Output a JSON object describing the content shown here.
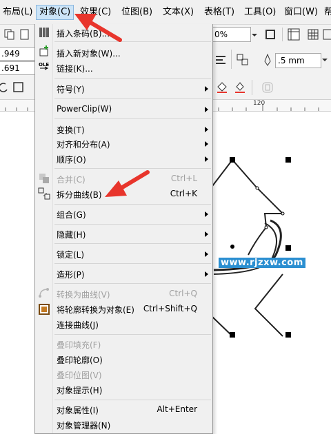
{
  "menubar": {
    "items": [
      {
        "label": "布局(L)"
      },
      {
        "label": "对象(C)"
      },
      {
        "label": "效果(C)"
      },
      {
        "label": "位图(B)"
      },
      {
        "label": "文本(X)"
      },
      {
        "label": "表格(T)"
      },
      {
        "label": "工具(O)"
      },
      {
        "label": "窗口(W)"
      },
      {
        "label": "帮"
      }
    ]
  },
  "toolbar": {
    "zoom_value": "0%",
    "outline_width": ".5 mm",
    "width_value": ".949 mm",
    "height_value": ".691 mm"
  },
  "ruler": {
    "label": "120"
  },
  "watermark": {
    "text": "www.rjzxw.com"
  },
  "menu": {
    "items": [
      {
        "label": "插入条码(B)...",
        "enabled": true
      },
      {
        "label": "插入新对象(W)...",
        "enabled": true
      },
      {
        "label": "链接(K)...",
        "enabled": true
      },
      {
        "label": "符号(Y)",
        "enabled": true,
        "submenu": true
      },
      {
        "label": "PowerClip(W)",
        "enabled": true,
        "submenu": true
      },
      {
        "label": "变换(T)",
        "enabled": true,
        "submenu": true
      },
      {
        "label": "对齐和分布(A)",
        "enabled": true,
        "submenu": true
      },
      {
        "label": "顺序(O)",
        "enabled": true,
        "submenu": true
      },
      {
        "label": "合并(C)",
        "enabled": false,
        "shortcut": "Ctrl+L"
      },
      {
        "label": "拆分曲线(B)",
        "enabled": true,
        "shortcut": "Ctrl+K"
      },
      {
        "label": "组合(G)",
        "enabled": true,
        "submenu": true
      },
      {
        "label": "隐藏(H)",
        "enabled": true,
        "submenu": true
      },
      {
        "label": "锁定(L)",
        "enabled": true,
        "submenu": true
      },
      {
        "label": "造形(P)",
        "enabled": true,
        "submenu": true
      },
      {
        "label": "转换为曲线(V)",
        "enabled": false,
        "shortcut": "Ctrl+Q"
      },
      {
        "label": "将轮廓转换为对象(E)",
        "enabled": true,
        "shortcut": "Ctrl+Shift+Q"
      },
      {
        "label": "连接曲线(J)",
        "enabled": true
      },
      {
        "label": "叠印填充(F)",
        "enabled": false
      },
      {
        "label": "叠印轮廓(O)",
        "enabled": true
      },
      {
        "label": "叠印位图(V)",
        "enabled": false
      },
      {
        "label": "对象提示(H)",
        "enabled": true
      },
      {
        "label": "对象属性(I)",
        "enabled": true,
        "shortcut": "Alt+Enter"
      },
      {
        "label": "对象管理器(N)",
        "enabled": true
      }
    ]
  },
  "icon_labels": {
    "ole": "OLE"
  },
  "colors": {
    "accent_red": "#e8352c",
    "menu_bg": "#f0f0f0",
    "highlight": "#cce4f7"
  }
}
